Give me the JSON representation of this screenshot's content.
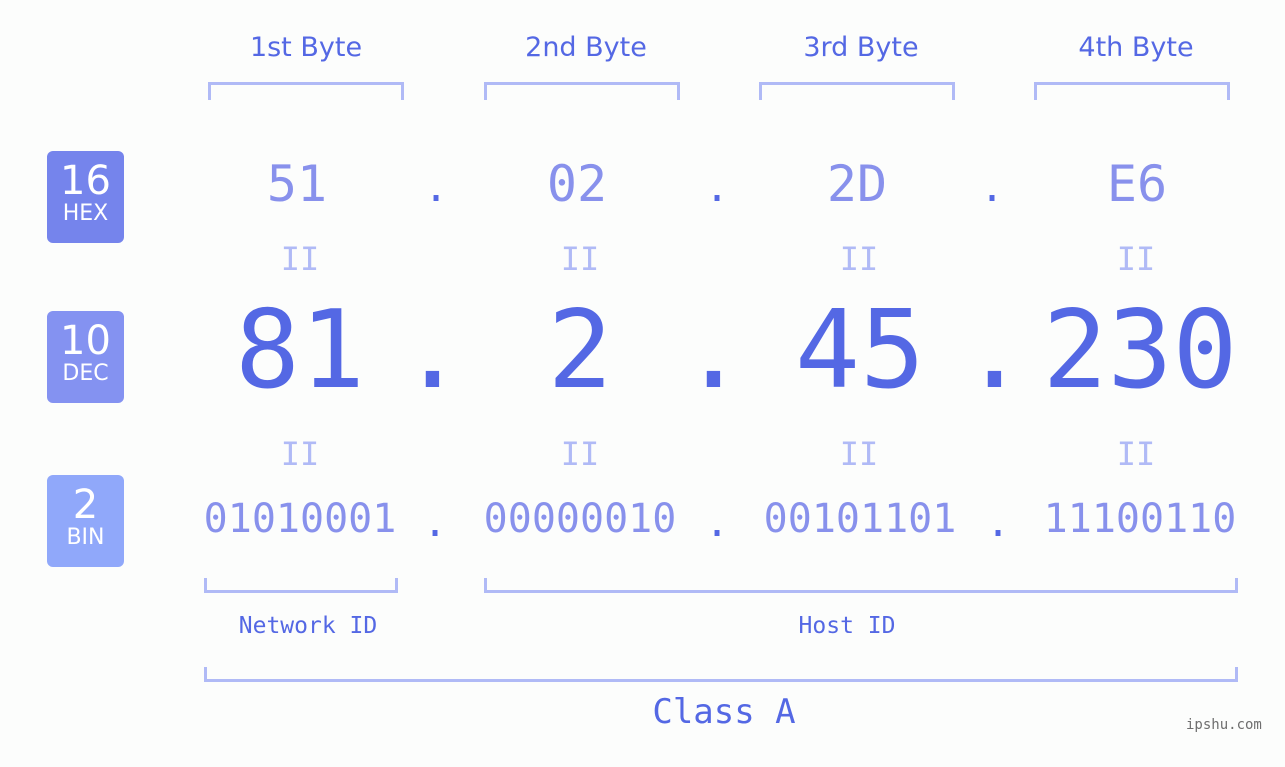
{
  "bytes": [
    {
      "label": "1st Byte",
      "hex": "51",
      "dec": "81",
      "bin": "01010001"
    },
    {
      "label": "2nd Byte",
      "hex": "02",
      "dec": "2",
      "bin": "00000010"
    },
    {
      "label": "3rd Byte",
      "hex": "2D",
      "dec": "45",
      "bin": "00101101"
    },
    {
      "label": "4th Byte",
      "hex": "E6",
      "dec": "230",
      "bin": "11100110"
    }
  ],
  "badges": {
    "hex": {
      "num": "16",
      "label": "HEX",
      "color": "#7584ec"
    },
    "dec": {
      "num": "10",
      "label": "DEC",
      "color": "#8492f1"
    },
    "bin": {
      "num": "2",
      "label": "BIN",
      "color": "#90a8fa"
    }
  },
  "separator": ".",
  "equals": "II",
  "network_id_label": "Network ID",
  "host_id_label": "Host ID",
  "class_label": "Class A",
  "watermark": "ipshu.com"
}
